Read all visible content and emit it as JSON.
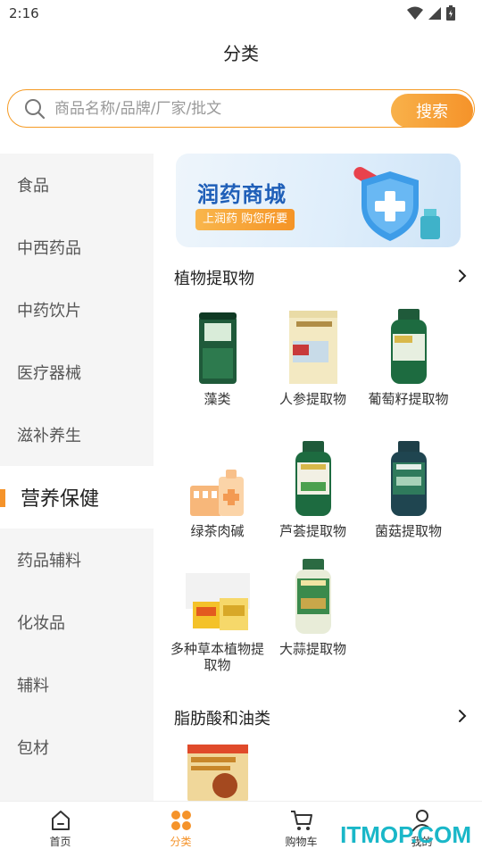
{
  "status_bar": {
    "time": "2:16"
  },
  "header": {
    "title": "分类"
  },
  "search": {
    "placeholder": "商品名称/品牌/厂家/批文",
    "button_label": "搜索"
  },
  "sidebar": {
    "items": [
      {
        "label": "食品",
        "active": false
      },
      {
        "label": "中西药品",
        "active": false
      },
      {
        "label": "中药饮片",
        "active": false
      },
      {
        "label": "医疗器械",
        "active": false
      },
      {
        "label": "滋补养生",
        "active": false
      },
      {
        "label": "营养保健",
        "active": true
      },
      {
        "label": "药品辅料",
        "active": false
      },
      {
        "label": "化妆品",
        "active": false
      },
      {
        "label": "辅料",
        "active": false
      },
      {
        "label": "包材",
        "active": false
      }
    ]
  },
  "banner": {
    "title": "润药商城",
    "subtitle": "上润药 购您所要"
  },
  "sections": [
    {
      "title": "植物提取物",
      "items": [
        {
          "label": "藻类"
        },
        {
          "label": "人参提取物"
        },
        {
          "label": "葡萄籽提取物"
        },
        {
          "label": "绿茶肉碱"
        },
        {
          "label": "芦荟提取物"
        },
        {
          "label": "菌菇提取物"
        },
        {
          "label": "多种草本植物提取物"
        },
        {
          "label": "大蒜提取物"
        }
      ]
    },
    {
      "title": "脂肪酸和油类",
      "items": [
        {
          "label": ""
        }
      ]
    }
  ],
  "bottom_nav": [
    {
      "label": "首页",
      "icon": "home-icon",
      "active": false
    },
    {
      "label": "分类",
      "icon": "category-icon",
      "active": true
    },
    {
      "label": "购物车",
      "icon": "cart-icon",
      "active": false
    },
    {
      "label": "我的",
      "icon": "user-icon",
      "active": false
    }
  ],
  "watermark": "ITMOP.COM",
  "colors": {
    "accent": "#f5932a",
    "brand_blue": "#1f5fb8",
    "sidebar_bg": "#f5f5f5"
  }
}
